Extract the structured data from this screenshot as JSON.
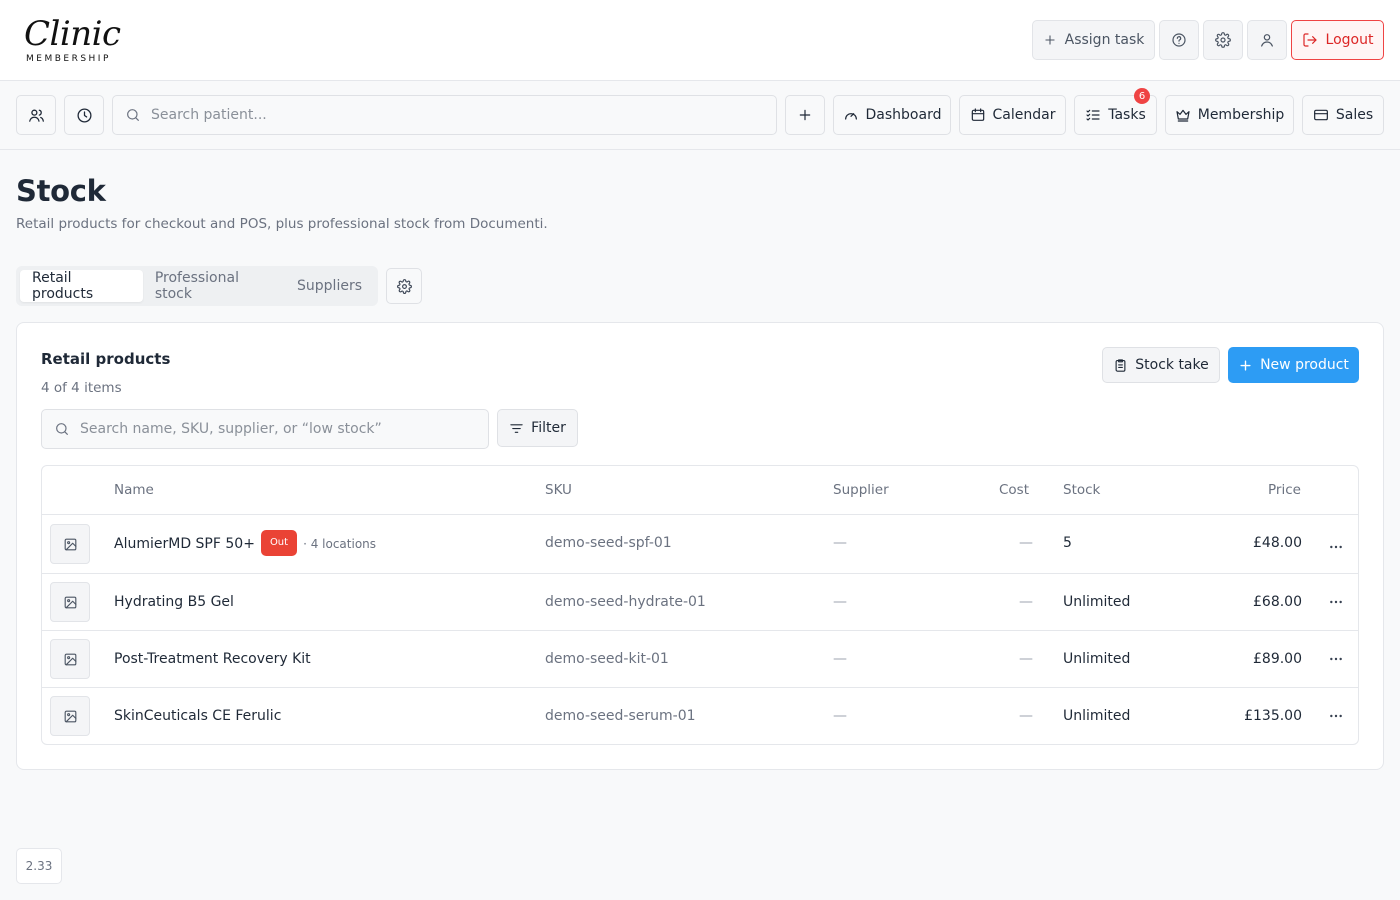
{
  "brand": {
    "logo_script": "Clinic",
    "logo_sub": "MEMBERSHIP"
  },
  "topbar": {
    "assign_task": "Assign task",
    "logout": "Logout",
    "icons": [
      "plus-icon",
      "help-circle-icon",
      "gear-icon",
      "user-icon",
      "logout-icon"
    ]
  },
  "nav": {
    "search_placeholder": "Search patient...",
    "dashboard": "Dashboard",
    "calendar": "Calendar",
    "tasks": "Tasks",
    "tasks_badge": "6",
    "membership": "Membership",
    "sales": "Sales"
  },
  "page": {
    "title": "Stock",
    "subtitle": "Retail products for checkout and POS, plus professional stock from Documenti."
  },
  "tabs": [
    {
      "label": "Retail products",
      "active": true
    },
    {
      "label": "Professional stock",
      "active": false
    },
    {
      "label": "Suppliers",
      "active": false
    }
  ],
  "card": {
    "title": "Retail products",
    "count": "4 of 4 items",
    "stock_take": "Stock take",
    "new_product": "New product",
    "search_placeholder": "Search name, SKU, supplier, or “low stock”",
    "filter": "Filter"
  },
  "table": {
    "columns": {
      "name": "Name",
      "sku": "SKU",
      "supplier": "Supplier",
      "cost": "Cost",
      "stock": "Stock",
      "price": "Price"
    },
    "rows": [
      {
        "name": "AlumierMD SPF 50+",
        "badge": "Out",
        "locations": "· 4 locations",
        "sku": "demo-seed-spf-01",
        "supplier": "—",
        "cost": "—",
        "stock": "5",
        "price": "£48.00"
      },
      {
        "name": "Hydrating B5 Gel",
        "sku": "demo-seed-hydrate-01",
        "supplier": "—",
        "cost": "—",
        "stock": "Unlimited",
        "price": "£68.00"
      },
      {
        "name": "Post-Treatment Recovery Kit",
        "sku": "demo-seed-kit-01",
        "supplier": "—",
        "cost": "—",
        "stock": "Unlimited",
        "price": "£89.00"
      },
      {
        "name": "SkinCeuticals CE Ferulic",
        "sku": "demo-seed-serum-01",
        "supplier": "—",
        "cost": "—",
        "stock": "Unlimited",
        "price": "£135.00"
      }
    ]
  },
  "version": "2.33",
  "colors": {
    "primary": "#2d9cf4",
    "danger": "#ef4444",
    "badge_out": "#ea4335"
  }
}
